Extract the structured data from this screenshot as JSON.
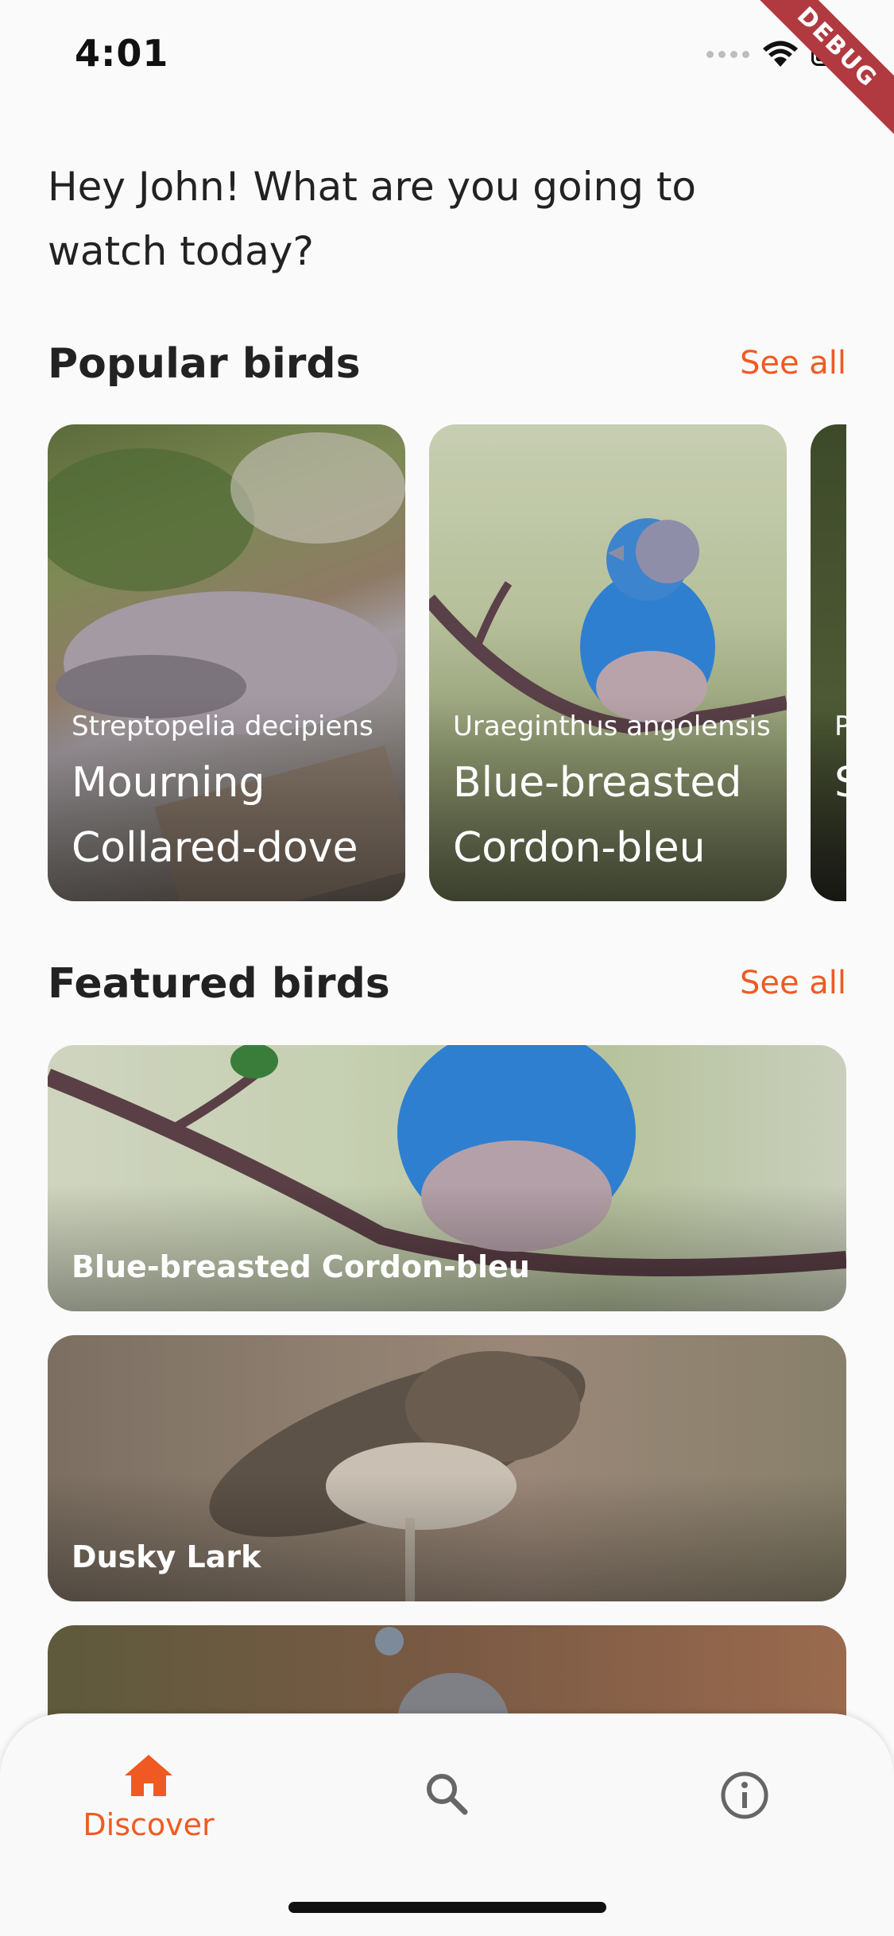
{
  "status_bar": {
    "time": "4:01",
    "debug_label": "DEBUG"
  },
  "greeting": "Hey John! What are you going to watch today?",
  "popular": {
    "title": "Popular birds",
    "see_all": "See all",
    "cards": [
      {
        "latin": "Streptopelia decipiens",
        "name": "Mourning Collared-dove"
      },
      {
        "latin": "Uraeginthus angolensis",
        "name": "Blue-breasted Cordon-bleu"
      },
      {
        "latin": "P",
        "name": "S f"
      }
    ]
  },
  "featured": {
    "title": "Featured birds",
    "see_all": "See all",
    "cards": [
      {
        "name": "Blue-breasted Cordon-bleu"
      },
      {
        "name": "Dusky Lark"
      },
      {
        "name": ""
      }
    ]
  },
  "bottom_nav": {
    "items": [
      {
        "label": "Discover",
        "icon": "home-icon",
        "active": true
      },
      {
        "label": "",
        "icon": "search-icon",
        "active": false
      },
      {
        "label": "",
        "icon": "info-icon",
        "active": false
      }
    ]
  },
  "colors": {
    "accent": "#f05a22",
    "background": "#fafafa",
    "text": "#222222"
  }
}
